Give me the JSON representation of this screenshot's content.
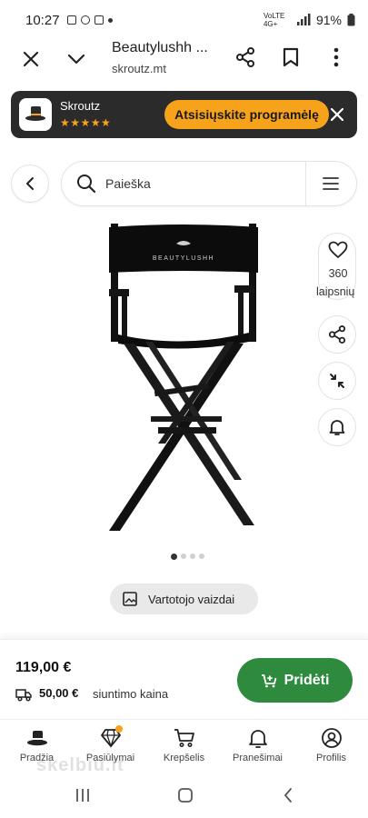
{
  "status": {
    "time": "10:27",
    "network": "VoLTE 4G+",
    "battery": "91%"
  },
  "tab": {
    "title": "Beautylushh ...",
    "url": "skroutz.mt"
  },
  "banner": {
    "app_name": "Skroutz",
    "stars": "★★★★★",
    "cta": "Atsisiųskite programėlę"
  },
  "search": {
    "placeholder": "Paieška"
  },
  "product": {
    "brand_on_chair": "BEAUTYLUSHH",
    "wishlist_count": "360",
    "wishlist_label": "laipsnių",
    "image_dots": 4,
    "active_dot": 0,
    "user_images_label": "Vartotojo vaizdai"
  },
  "purchase": {
    "price": "119,00 €",
    "shipping_value": "50,00 €",
    "shipping_label": "siuntimo kaina",
    "add_label": "Pridėti"
  },
  "bottom_nav": [
    {
      "label": "Pradžia",
      "icon": "hat-icon"
    },
    {
      "label": "Pasiūlymai",
      "icon": "diamond-icon"
    },
    {
      "label": "Krepšelis",
      "icon": "cart-icon"
    },
    {
      "label": "Pranešimai",
      "icon": "bell-icon"
    },
    {
      "label": "Profilis",
      "icon": "profile-icon"
    }
  ],
  "watermark": "skelbiu.lt",
  "colors": {
    "accent_orange": "#f7a21b",
    "add_green": "#2e8b3d",
    "banner_dark": "#2b2b2b"
  }
}
